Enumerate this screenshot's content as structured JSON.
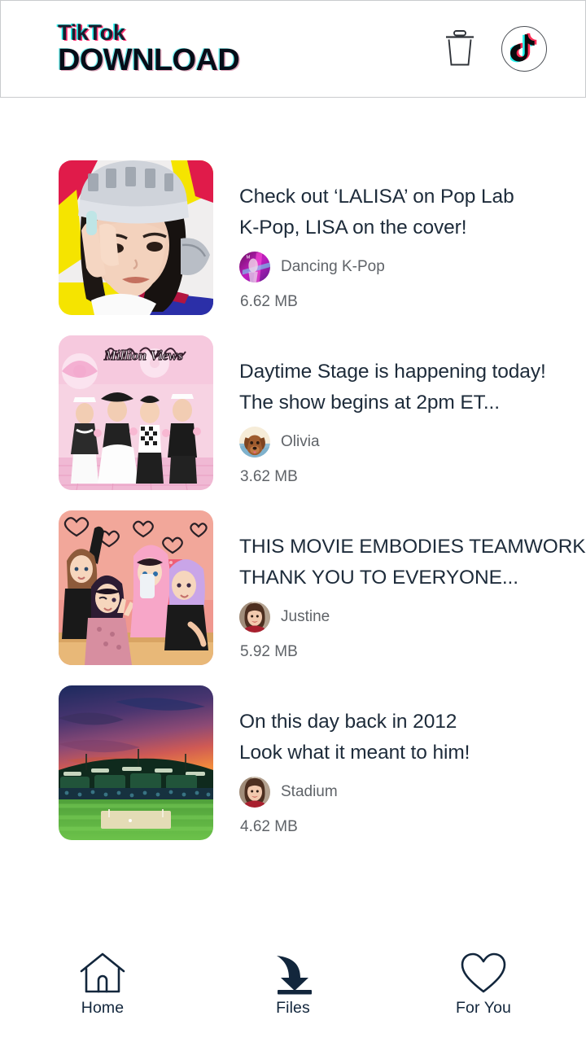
{
  "header": {
    "logo_line1": "TikTok",
    "logo_line2": "DOWNLOAD",
    "trash_icon": "trash-icon",
    "tiktok_icon": "tiktok-logo-icon",
    "border_color": "#c9cbcd"
  },
  "colors": {
    "title_text": "#1d2b3a",
    "secondary_text": "#5f6368",
    "nav_text": "#12263c",
    "tiktok_cyan": "#25f4ee",
    "tiktok_pink": "#fe2c55",
    "background": "#ffffff"
  },
  "downloads": [
    {
      "title": "Check out ‘LALISA’ on Pop Lab\nK-Pop, LISA on the cover!",
      "author": "Dancing K-Pop",
      "size": "6.62 MB",
      "thumb": "lisa-portrait-thumbnail",
      "avatar": "dancing-kpop-avatar"
    },
    {
      "title": "Daytime Stage is happening today!\nThe show begins at 2pm ET...",
      "author": "Olivia",
      "size": "3.62 MB",
      "thumb": "million-views-group-thumbnail",
      "avatar": "olivia-dog-avatar"
    },
    {
      "title": "THIS MOVIE EMBODIES TEAMWORK\nTHANK YOU TO EVERYONE...",
      "author": "Justine",
      "size": "5.92 MB",
      "thumb": "animated-girls-thumbnail",
      "avatar": "justine-avatar"
    },
    {
      "title": "On this day back in 2012\nLook what it meant to him!",
      "author": "Stadium",
      "size": "4.62 MB",
      "thumb": "stadium-sunset-thumbnail",
      "avatar": "stadium-avatar"
    }
  ],
  "bottom_nav": {
    "items": [
      {
        "label": "Home",
        "icon": "home-icon",
        "active": false
      },
      {
        "label": "Files",
        "icon": "download-arrow-icon",
        "active": true
      },
      {
        "label": "For You",
        "icon": "heart-icon",
        "active": false
      }
    ]
  }
}
